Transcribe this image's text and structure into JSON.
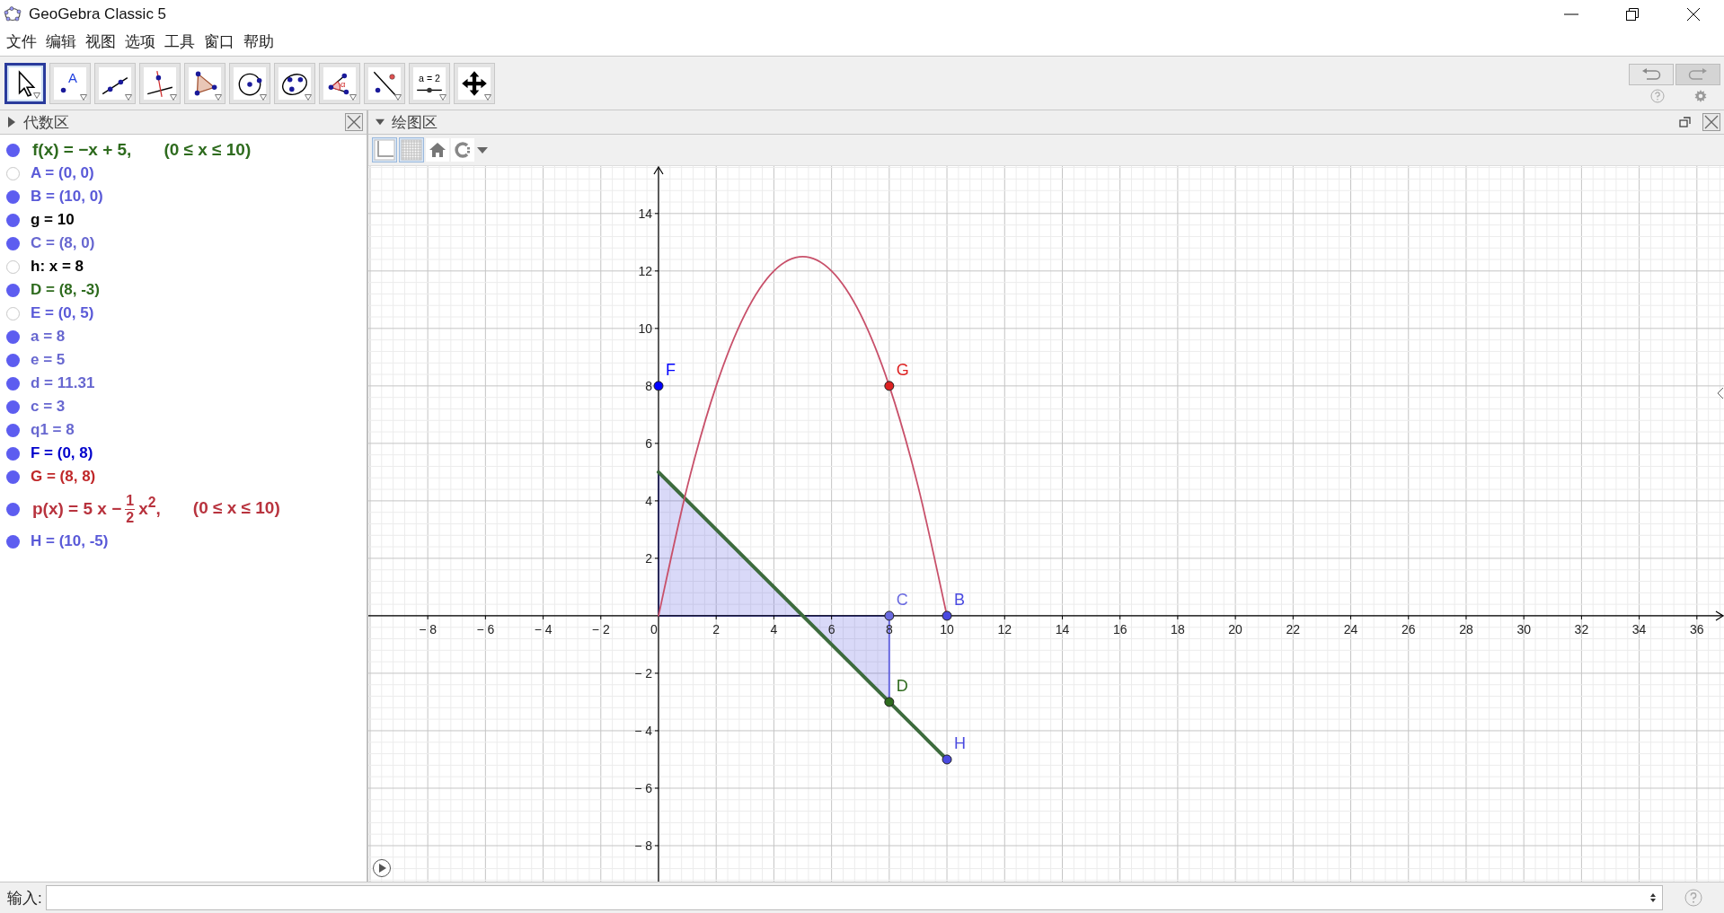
{
  "window": {
    "title": "GeoGebra Classic 5"
  },
  "menu": [
    "文件",
    "编辑",
    "视图",
    "选项",
    "工具",
    "窗口",
    "帮助"
  ],
  "toolbar": [
    {
      "kind": "move",
      "selected": true
    },
    {
      "kind": "point",
      "label": "A",
      "selected": false
    },
    {
      "kind": "line",
      "selected": false
    },
    {
      "kind": "perpendicular",
      "selected": false
    },
    {
      "kind": "polygon",
      "selected": false
    },
    {
      "kind": "circle",
      "selected": false
    },
    {
      "kind": "conic",
      "selected": false
    },
    {
      "kind": "angle",
      "label": "α",
      "selected": false
    },
    {
      "kind": "reflect",
      "selected": false
    },
    {
      "kind": "slider",
      "label": "a = 2",
      "selected": false
    },
    {
      "kind": "move-view",
      "selected": false
    }
  ],
  "algebra": {
    "title": "代数区",
    "items": [
      {
        "kind": "function",
        "text": "f(x) = −x + 5,",
        "domain": "(0 ≤ x ≤ 10)",
        "color": "#2e6b1e",
        "visible": true
      },
      {
        "kind": "plain",
        "text": "A = (0, 0)",
        "color": "#5a5ad8",
        "visible": false
      },
      {
        "kind": "plain",
        "text": "B = (10, 0)",
        "color": "#5a5ad8",
        "visible": true
      },
      {
        "kind": "plain",
        "text": "g = 10",
        "color": "#000000",
        "visible": true
      },
      {
        "kind": "plain",
        "text": "C = (8, 0)",
        "color": "#6767d0",
        "visible": true
      },
      {
        "kind": "plain",
        "text": "h: x = 8",
        "color": "#000000",
        "visible": false
      },
      {
        "kind": "plain",
        "text": "D = (8, -3)",
        "color": "#2e6b1e",
        "visible": true
      },
      {
        "kind": "plain",
        "text": "E = (0, 5)",
        "color": "#5a5ad8",
        "visible": false
      },
      {
        "kind": "plain",
        "text": "a = 8",
        "color": "#6767d0",
        "visible": true
      },
      {
        "kind": "plain",
        "text": "e = 5",
        "color": "#6767d0",
        "visible": true
      },
      {
        "kind": "plain",
        "text": "d = 11.31",
        "color": "#6767d0",
        "visible": true
      },
      {
        "kind": "plain",
        "text": "c = 3",
        "color": "#6767d0",
        "visible": true
      },
      {
        "kind": "plain",
        "text": "q1 = 8",
        "color": "#6767d0",
        "visible": true
      },
      {
        "kind": "plain",
        "text": "F = (0, 8)",
        "color": "#0000cc",
        "visible": true
      },
      {
        "kind": "plain",
        "text": "G = (8, 8)",
        "color": "#c0282a",
        "visible": true
      },
      {
        "kind": "fraction",
        "before": "p(x) = 5 x −",
        "numerator": "1",
        "denominator": "2",
        "after": "x$^{2}$,",
        "domain": "(0 ≤ x ≤ 10)",
        "color": "#b8333e",
        "visible": true
      },
      {
        "kind": "plain",
        "text": "H = (10, -5)",
        "color": "#5a5ad8",
        "visible": true
      }
    ]
  },
  "graphics": {
    "title": "绘图区",
    "axes": true,
    "chart_data": {
      "type": "line",
      "grid": true,
      "xlim": [
        -10.06,
        36.94
      ],
      "ylim": [
        -9.25,
        15.65
      ],
      "xticks": [
        {
          "value": -8,
          "label": "− 8"
        },
        {
          "value": -6,
          "label": "− 6"
        },
        {
          "value": -4,
          "label": "− 4"
        },
        {
          "value": -2,
          "label": "− 2"
        },
        0,
        2,
        4,
        6,
        8,
        10,
        12,
        14,
        16,
        18,
        20,
        22,
        24,
        26,
        28,
        30,
        32,
        34,
        36
      ],
      "yticks": [
        {
          "value": -8,
          "label": "− 8"
        },
        {
          "value": -6,
          "label": "− 6"
        },
        {
          "value": -4,
          "label": "− 4"
        },
        {
          "value": -2,
          "label": "− 2"
        },
        2,
        4,
        6,
        8,
        10,
        12,
        14
      ],
      "x": [
        0,
        1,
        2,
        3,
        4,
        5,
        6,
        7,
        8,
        9,
        10
      ],
      "series": [
        {
          "color": "#3d6b3d",
          "values": [
            5,
            4,
            3,
            2,
            1,
            0,
            -1,
            -2,
            -3,
            -4,
            -5
          ]
        },
        {
          "color": "#c8506a",
          "values": [
            0,
            4.5,
            8,
            10.5,
            12,
            12.5,
            12,
            10.5,
            8,
            4.5,
            0
          ]
        },
        {
          "type": "area",
          "color": "#5050e0",
          "values": [
            5,
            4,
            3,
            2,
            1,
            0,
            -1,
            -2,
            -3,
            null,
            null
          ]
        },
        {
          "name": "F",
          "color": "#0000ff",
          "marker": "circle",
          "values": [
            8,
            null,
            null,
            null,
            null,
            null,
            null,
            null,
            null,
            null,
            null
          ]
        },
        {
          "name": "G",
          "color": "#dd2222",
          "marker": "circle",
          "values": [
            null,
            null,
            null,
            null,
            null,
            null,
            null,
            null,
            8,
            null,
            null
          ]
        },
        {
          "name": "C",
          "color": "#6a6ae0",
          "marker": "circle",
          "values": [
            null,
            null,
            null,
            null,
            null,
            null,
            null,
            null,
            0,
            null,
            null
          ]
        },
        {
          "name": "B",
          "color": "#4a4ae0",
          "marker": "circle",
          "values": [
            null,
            null,
            null,
            null,
            null,
            null,
            null,
            null,
            null,
            null,
            0
          ]
        },
        {
          "name": "D",
          "color": "#2e6b1e",
          "marker": "circle",
          "values": [
            null,
            null,
            null,
            null,
            null,
            null,
            null,
            null,
            -3,
            null,
            null
          ]
        },
        {
          "name": "H",
          "color": "#4a4ae0",
          "marker": "circle",
          "values": [
            null,
            null,
            null,
            null,
            null,
            null,
            null,
            null,
            null,
            null,
            -5
          ]
        }
      ]
    }
  },
  "input": {
    "label": "输入:"
  }
}
